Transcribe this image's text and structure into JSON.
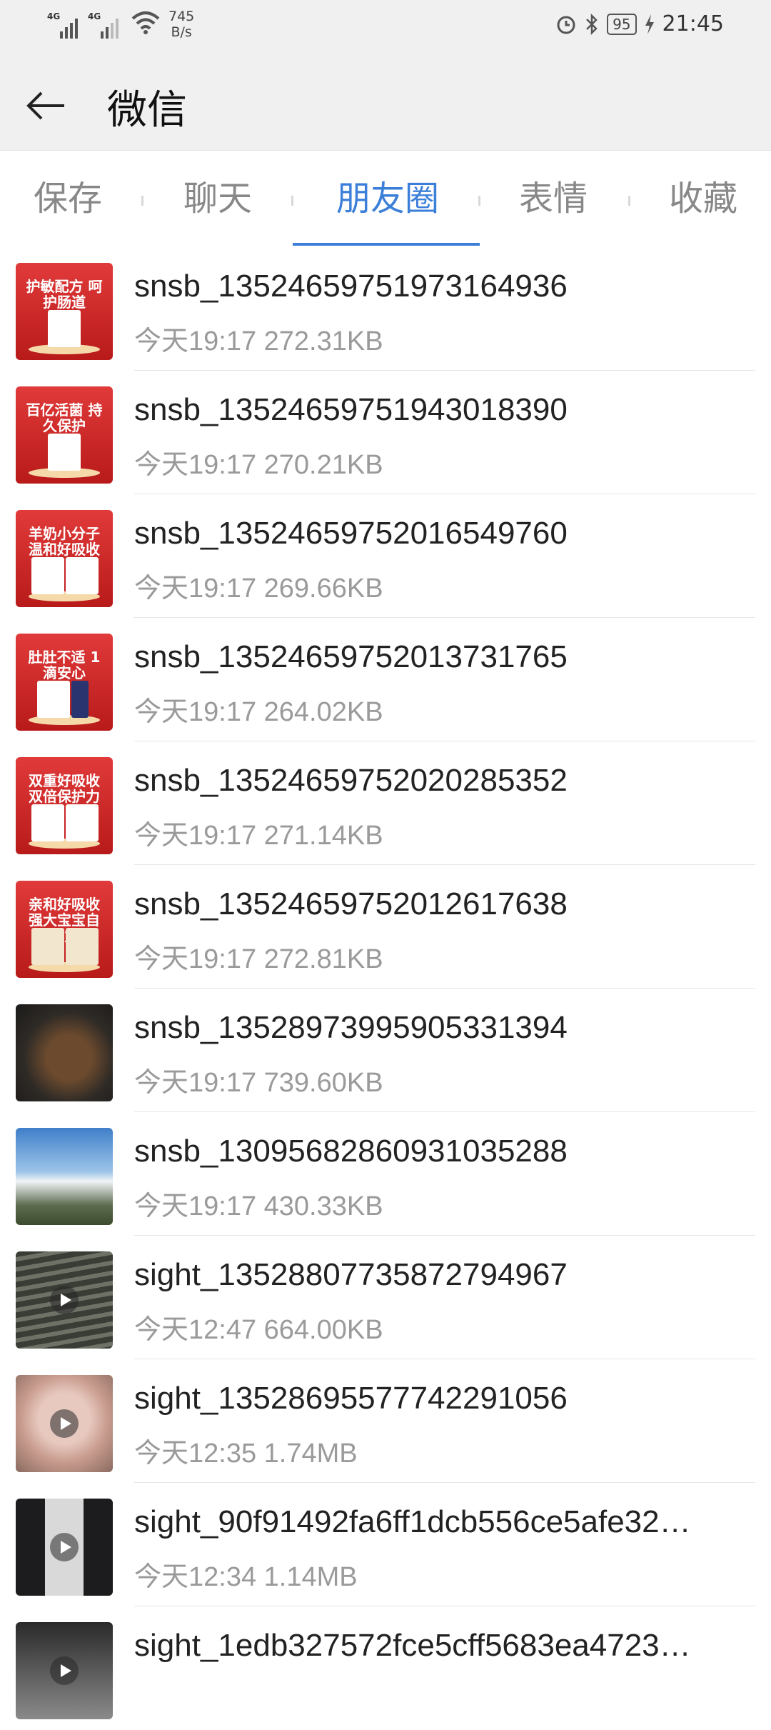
{
  "status_bar": {
    "signal1_label": "4G",
    "signal2_label": "4G",
    "net_speed_value": "745",
    "net_speed_unit": "B/s",
    "battery": "95",
    "time": "21:45"
  },
  "app_bar": {
    "title": "微信"
  },
  "tabs": [
    {
      "label": "保存"
    },
    {
      "label": "聊天"
    },
    {
      "label": "朋友圈"
    },
    {
      "label": "表情"
    },
    {
      "label": "收藏"
    }
  ],
  "active_tab": "朋友圈",
  "files": [
    {
      "name": "snsb_13524659751973164936",
      "meta": "今天19:17 272.31KB",
      "thumb": "ad",
      "ad_text": "护敏配方 呵护肠道"
    },
    {
      "name": "snsb_13524659751943018390",
      "meta": "今天19:17 270.21KB",
      "thumb": "ad",
      "ad_text": "百亿活菌 持久保护"
    },
    {
      "name": "snsb_13524659752016549760",
      "meta": "今天19:17 269.66KB",
      "thumb": "ad",
      "ad_text": "羊奶小分子 温和好吸收"
    },
    {
      "name": "snsb_13524659752013731765",
      "meta": "今天19:17 264.02KB",
      "thumb": "ad",
      "ad_text": "肚肚不适 1滴安心"
    },
    {
      "name": "snsb_13524659752020285352",
      "meta": "今天19:17 271.14KB",
      "thumb": "ad",
      "ad_text": "双重好吸收 双倍保护力"
    },
    {
      "name": "snsb_13524659752012617638",
      "meta": "今天19:17 272.81KB",
      "thumb": "ad",
      "ad_text": "亲和好吸收 强大宝宝自护力"
    },
    {
      "name": "snsb_13528973995905331394",
      "meta": "今天19:17 739.60KB",
      "thumb": "food"
    },
    {
      "name": "snsb_13095682860931035288",
      "meta": "今天19:17 430.33KB",
      "thumb": "sky"
    },
    {
      "name": "sight_13528807735872794967",
      "meta": "今天12:47 664.00KB",
      "thumb": "field"
    },
    {
      "name": "sight_13528695577742291056",
      "meta": "今天12:35 1.74MB",
      "thumb": "pink"
    },
    {
      "name": "sight_90f91492fa6ff1dcb556ce5afe32…",
      "meta": "今天12:34 1.14MB",
      "thumb": "person"
    },
    {
      "name": "sight_1edb327572fce5cff5683ea4723…",
      "meta": "",
      "thumb": "dark"
    }
  ],
  "colors": {
    "accent": "#3b7fd9",
    "ad_red": "#d42a2a"
  }
}
